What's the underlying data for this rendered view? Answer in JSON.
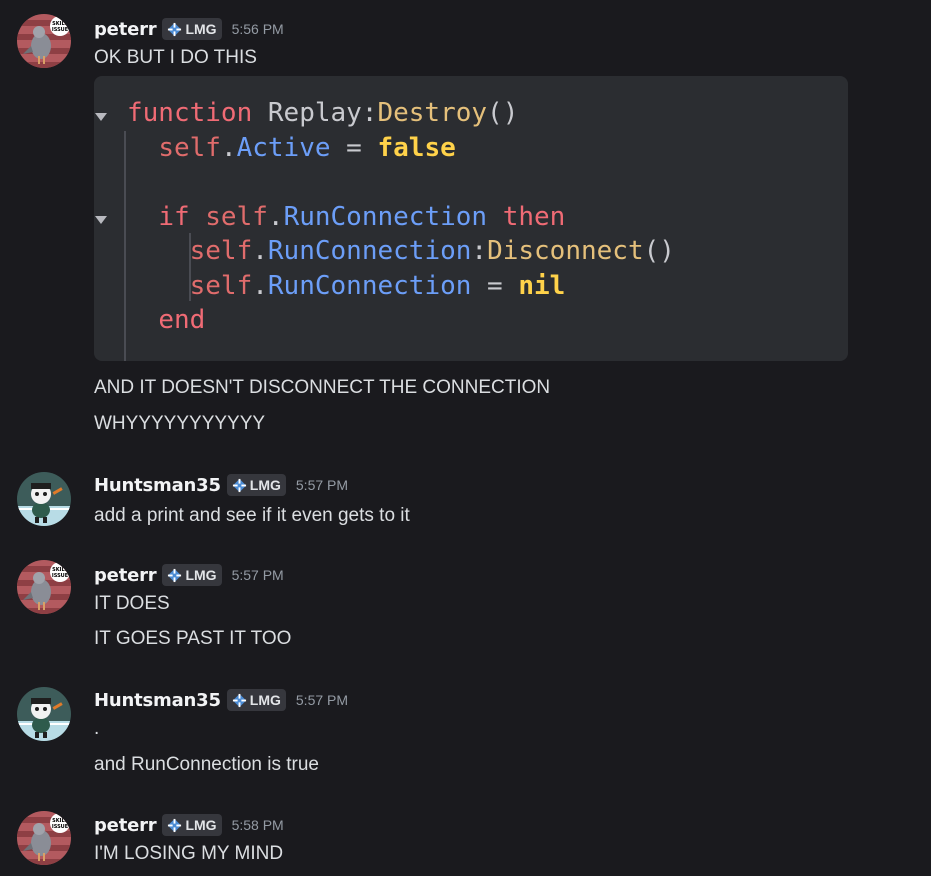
{
  "messages": [
    {
      "username": "peterr",
      "tag": "LMG",
      "time": "5:56 PM",
      "lines": [
        "OK BUT I DO THIS"
      ],
      "after_code": [
        "AND IT DOESN'T DISCONNECT THE CONNECTION",
        "WHYYYYYYYYYYY"
      ]
    },
    {
      "username": "Huntsman35",
      "tag": "LMG",
      "time": "5:57 PM",
      "lines": [
        "add a print and see if it even gets to it"
      ]
    },
    {
      "username": "peterr",
      "tag": "LMG",
      "time": "5:57 PM",
      "lines": [
        "IT DOES",
        "IT GOES PAST IT TOO"
      ]
    },
    {
      "username": "Huntsman35",
      "tag": "LMG",
      "time": "5:57 PM",
      "lines": [
        ".",
        "and RunConnection is true"
      ]
    },
    {
      "username": "peterr",
      "tag": "LMG",
      "time": "5:58 PM",
      "lines": [
        "I'M LOSING MY MIND"
      ]
    }
  ],
  "code": {
    "language": "lua",
    "tokens": {
      "l1_kw": "function",
      "l1_name": " Replay:",
      "l1_fn": "Destroy",
      "l1_paren": "()",
      "l2_self": "self",
      "l2_dot": ".",
      "l2_prop": "Active",
      "l2_eq": " = ",
      "l2_val": "false",
      "l4_kw": "if ",
      "l4_self": "self",
      "l4_dot": ".",
      "l4_prop": "RunConnection",
      "l4_then": " then",
      "l5_self": "self",
      "l5_dot": ".",
      "l5_prop": "RunConnection",
      "l5_colon": ":",
      "l5_fn": "Disconnect",
      "l5_paren": "()",
      "l6_self": "self",
      "l6_dot": ".",
      "l6_prop": "RunConnection",
      "l6_eq": " = ",
      "l6_val": "nil",
      "l7_kw": "end"
    }
  },
  "colors": {
    "background": "#1a1a1e",
    "codeblock": "#2b2d31",
    "keyword": "#f06b75",
    "property": "#6c9ef8",
    "function": "#e5c07b",
    "literal": "#ffd24a",
    "timestamp": "#949ba4",
    "tag_bg": "#36373d"
  },
  "icons": {
    "tag_icon": "diamond-crosshair-icon",
    "peterr_avatar": "skill-issue-pigeon-avatar",
    "huntsman_avatar": "cartoon-character-avatar"
  }
}
